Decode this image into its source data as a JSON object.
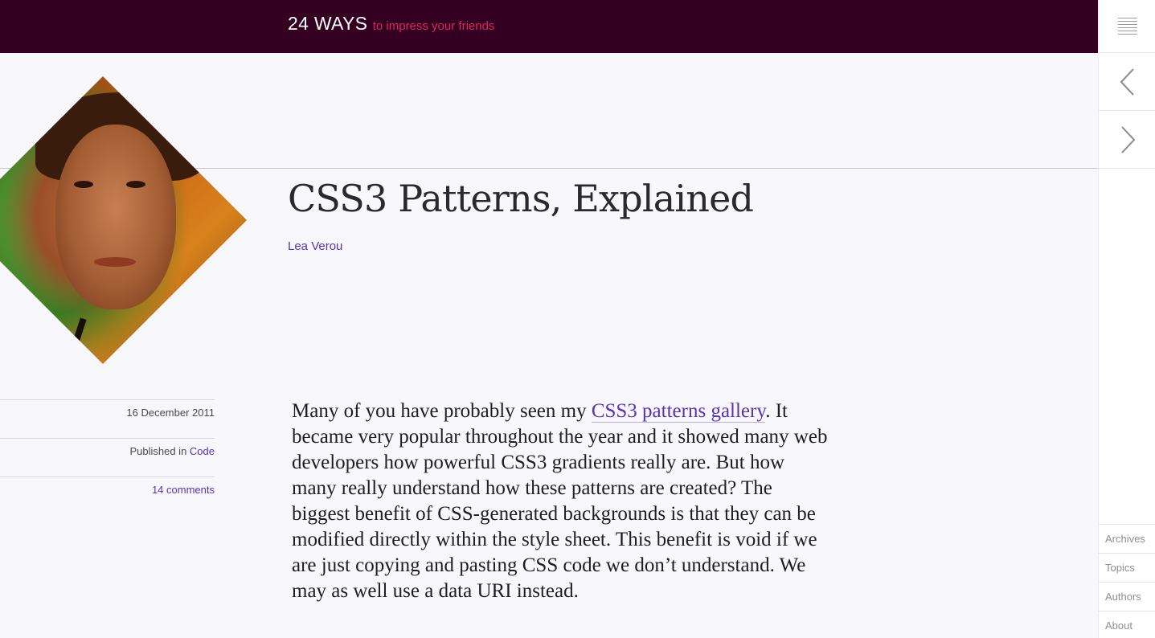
{
  "site": {
    "name": "24 WAYS",
    "tagline": "to impress your friends"
  },
  "article": {
    "title": "CSS3 Patterns, Explained",
    "author": "Lea Verou",
    "date": "16 December 2011",
    "published_prefix": "Published in",
    "category": "Code",
    "comments": "14 comments",
    "intro_before": "Many of you have probably seen my ",
    "intro_link": "CSS3 patterns gallery",
    "intro_after": ". It became very popular throughout the year and it showed many web developers how powerful CSS3 gradients really are. But how many really understand how these patterns are created? The biggest benefit of CSS-generated backgrounds is that they can be modified directly within the style sheet. This benefit is void if we are just copying and pasting CSS code we don’t understand. We may as well use a data URI instead."
  },
  "nav": {
    "links": [
      "Archives",
      "Topics",
      "Authors",
      "About"
    ]
  },
  "icons": {
    "menu": "menu-icon",
    "prev": "chevron-left-icon",
    "next": "chevron-right-icon"
  },
  "colors": {
    "header_bg": "#330022",
    "tagline": "#e0245e",
    "link": "#5533bb",
    "page_bg": "#f8f7fb"
  }
}
